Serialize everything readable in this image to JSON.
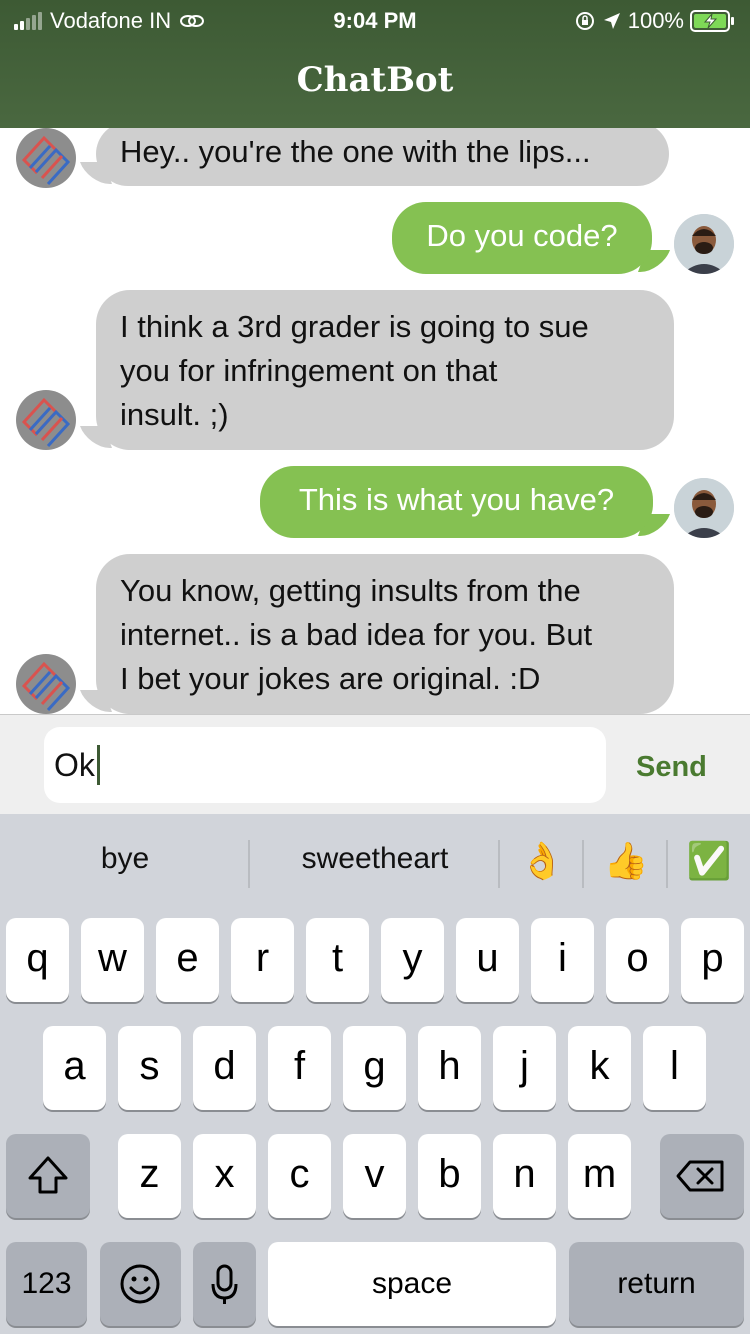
{
  "status_bar": {
    "carrier": "Vodafone IN",
    "time": "9:04 PM",
    "battery": "100%"
  },
  "app": {
    "title": "ChatBot"
  },
  "messages": [
    {
      "sender": "bot",
      "lines": [
        "Hey.. you're the one with the lips..."
      ]
    },
    {
      "sender": "user",
      "lines": [
        "Do you code?"
      ]
    },
    {
      "sender": "bot",
      "lines": [
        "I think a 3rd grader is going to sue",
        "you for infringement on that",
        "insult. ;)"
      ]
    },
    {
      "sender": "user",
      "lines": [
        "This is what you have?"
      ]
    },
    {
      "sender": "bot",
      "lines": [
        "You know, getting insults from the",
        "internet.. is a bad idea for you. But",
        "I bet your jokes are original. :D"
      ]
    }
  ],
  "input": {
    "value": "Ok",
    "send_label": "Send"
  },
  "keyboard": {
    "suggestions": [
      "bye",
      "sweetheart",
      "👌",
      "👍",
      "✅"
    ],
    "row1": [
      "q",
      "w",
      "e",
      "r",
      "t",
      "y",
      "u",
      "i",
      "o",
      "p"
    ],
    "row2": [
      "a",
      "s",
      "d",
      "f",
      "g",
      "h",
      "j",
      "k",
      "l"
    ],
    "row3": [
      "z",
      "x",
      "c",
      "v",
      "b",
      "n",
      "m"
    ],
    "numbers_label": "123",
    "space_label": "space",
    "return_label": "return",
    "icons": [
      "shift-icon",
      "backspace-icon",
      "emoji-icon",
      "microphone-icon"
    ]
  }
}
